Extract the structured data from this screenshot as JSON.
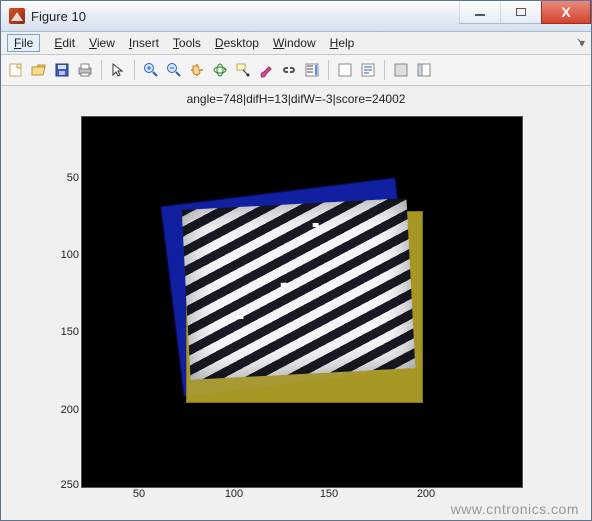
{
  "window": {
    "title": "Figure 10",
    "buttons": {
      "min": "min",
      "max": "max",
      "close": "X"
    }
  },
  "menubar": {
    "items": [
      {
        "label": "File",
        "accel": "F"
      },
      {
        "label": "Edit",
        "accel": "E"
      },
      {
        "label": "View",
        "accel": "V"
      },
      {
        "label": "Insert",
        "accel": "I"
      },
      {
        "label": "Tools",
        "accel": "T"
      },
      {
        "label": "Desktop",
        "accel": "D"
      },
      {
        "label": "Window",
        "accel": "W"
      },
      {
        "label": "Help",
        "accel": "H"
      }
    ],
    "dock_hint": "▾"
  },
  "toolbar": {
    "icons": [
      "new-figure-icon",
      "open-icon",
      "save-icon",
      "print-icon",
      "sep",
      "pointer-icon",
      "sep",
      "zoom-in-icon",
      "zoom-out-icon",
      "pan-icon",
      "rotate3d-icon",
      "datacursor-icon",
      "brush-icon",
      "link-icon",
      "colorbar-icon",
      "sep",
      "legend-icon",
      "annotation-icon",
      "sep",
      "hide-tools-icon",
      "show-tools-icon"
    ]
  },
  "plot": {
    "title": "angle=748|difH=13|difW=-3|score=24002"
  },
  "chart_data": {
    "type": "heatmap",
    "title": "angle=748|difH=13|difW=-3|score=24002",
    "xlabel": "",
    "ylabel": "",
    "xlim": [
      20,
      250
    ],
    "ylim": [
      10,
      250
    ],
    "y_reversed": true,
    "x_ticks": [
      50,
      100,
      150,
      200
    ],
    "y_ticks": [
      50,
      100,
      150,
      200,
      250
    ],
    "annotations": {
      "angle": 748,
      "difH": 13,
      "difW": -3,
      "score": 24002
    },
    "overlays": [
      {
        "name": "reference-rect",
        "color": "#1020a0",
        "approx_bbox": {
          "x": [
            59,
            195
          ],
          "y": [
            52,
            180
          ]
        },
        "rotation_deg": -7
      },
      {
        "name": "candidate-rect",
        "color": "#b8a82a",
        "approx_bbox": {
          "x": [
            67,
            203
          ],
          "y": [
            65,
            192
          ]
        },
        "rotation_deg": 0
      },
      {
        "name": "fringe-pattern",
        "description": "diagonal interference fringes",
        "approx_bbox": {
          "x": [
            67,
            197
          ],
          "y": [
            60,
            175
          ]
        },
        "rotation_deg": -3
      }
    ]
  },
  "watermark": "www.cntronics.com"
}
